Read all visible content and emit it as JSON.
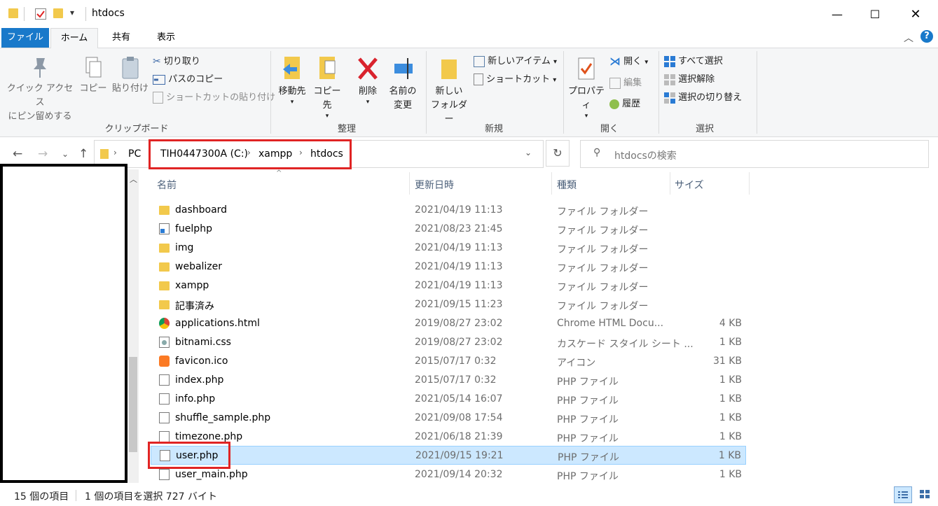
{
  "window": {
    "title": "htdocs"
  },
  "tabs": [
    {
      "label": "ファイル"
    },
    {
      "label": "ホーム"
    },
    {
      "label": "共有"
    },
    {
      "label": "表示"
    }
  ],
  "ribbon": {
    "clipboard": {
      "pin_label_1": "クイック アクセス",
      "pin_label_2": "にピン留めする",
      "copy": "コピー",
      "paste": "貼り付け",
      "cut": "切り取り",
      "copy_path": "パスのコピー",
      "paste_shortcut": "ショートカットの貼り付け",
      "group": "クリップボード"
    },
    "organize": {
      "move_to": "移動先",
      "copy_to": "コピー先",
      "delete": "削除",
      "rename_1": "名前の",
      "rename_2": "変更",
      "group": "整理"
    },
    "new": {
      "new_folder_1": "新しい",
      "new_folder_2": "フォルダー",
      "new_item": "新しいアイテム",
      "shortcut": "ショートカット",
      "group": "新規"
    },
    "open": {
      "properties": "プロパティ",
      "open": "開く",
      "edit": "編集",
      "history": "履歴",
      "group": "開く"
    },
    "select": {
      "select_all": "すべて選択",
      "select_none": "選択解除",
      "invert": "選択の切り替え",
      "group": "選択"
    }
  },
  "address": {
    "crumbs": [
      "PC",
      "TIH0447300A (C:)",
      "xampp",
      "htdocs"
    ],
    "search_placeholder": "htdocsの検索"
  },
  "columns": {
    "name": "名前",
    "date": "更新日時",
    "type": "種類",
    "size": "サイズ"
  },
  "files": [
    {
      "name": "dashboard",
      "date": "2021/04/19 11:13",
      "type": "ファイル フォルダー",
      "size": "",
      "icon": "folder"
    },
    {
      "name": "fuelphp",
      "date": "2021/08/23 21:45",
      "type": "ファイル フォルダー",
      "size": "",
      "icon": "shortcut-folder"
    },
    {
      "name": "img",
      "date": "2021/04/19 11:13",
      "type": "ファイル フォルダー",
      "size": "",
      "icon": "folder"
    },
    {
      "name": "webalizer",
      "date": "2021/04/19 11:13",
      "type": "ファイル フォルダー",
      "size": "",
      "icon": "folder"
    },
    {
      "name": "xampp",
      "date": "2021/04/19 11:13",
      "type": "ファイル フォルダー",
      "size": "",
      "icon": "folder"
    },
    {
      "name": "記事済み",
      "date": "2021/09/15 11:23",
      "type": "ファイル フォルダー",
      "size": "",
      "icon": "folder"
    },
    {
      "name": "applications.html",
      "date": "2019/08/27 23:02",
      "type": "Chrome HTML Docu...",
      "size": "4 KB",
      "icon": "chrome"
    },
    {
      "name": "bitnami.css",
      "date": "2019/08/27 23:02",
      "type": "カスケード スタイル シート ...",
      "size": "1 KB",
      "icon": "css"
    },
    {
      "name": "favicon.ico",
      "date": "2015/07/17 0:32",
      "type": "アイコン",
      "size": "31 KB",
      "icon": "xampp"
    },
    {
      "name": "index.php",
      "date": "2015/07/17 0:32",
      "type": "PHP ファイル",
      "size": "1 KB",
      "icon": "doc"
    },
    {
      "name": "info.php",
      "date": "2021/05/14 16:07",
      "type": "PHP ファイル",
      "size": "1 KB",
      "icon": "doc"
    },
    {
      "name": "shuffle_sample.php",
      "date": "2021/09/08 17:54",
      "type": "PHP ファイル",
      "size": "1 KB",
      "icon": "doc"
    },
    {
      "name": "timezone.php",
      "date": "2021/06/18 21:39",
      "type": "PHP ファイル",
      "size": "1 KB",
      "icon": "doc"
    },
    {
      "name": "user.php",
      "date": "2021/09/15 19:21",
      "type": "PHP ファイル",
      "size": "1 KB",
      "icon": "doc",
      "selected": true
    },
    {
      "name": "user_main.php",
      "date": "2021/09/14 20:32",
      "type": "PHP ファイル",
      "size": "1 KB",
      "icon": "doc"
    }
  ],
  "status": {
    "count": "15 個の項目",
    "selected": "1 個の項目を選択  727 バイト"
  },
  "colors": {
    "accent": "#1979ca",
    "selection": "#cce8ff",
    "highlight": "#e02424"
  }
}
